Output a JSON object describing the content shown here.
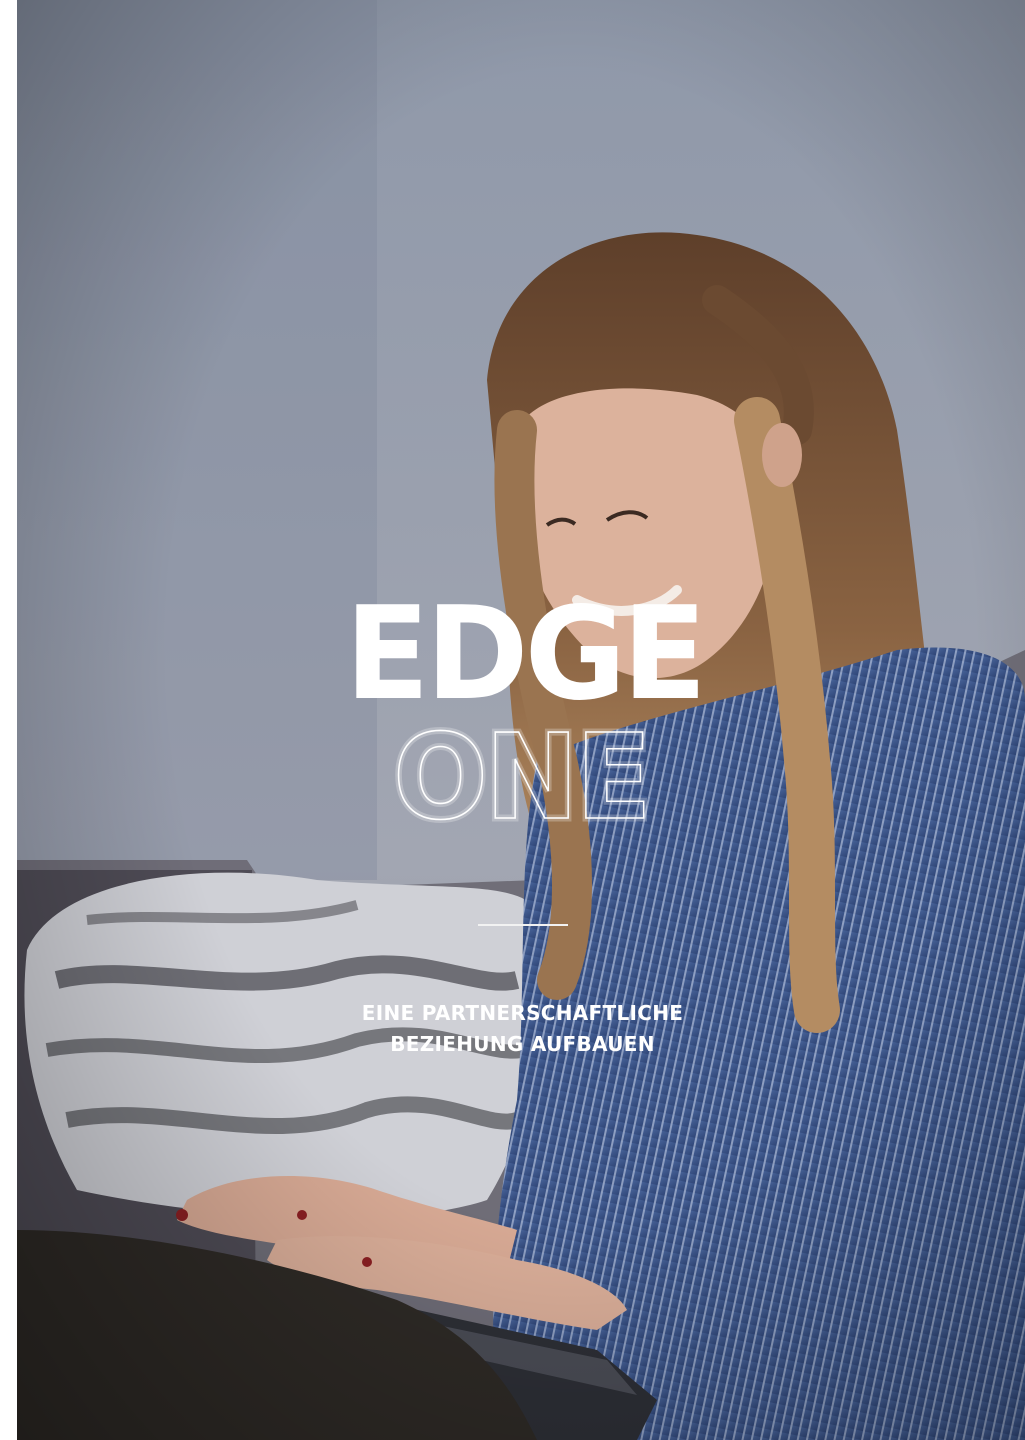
{
  "cover": {
    "title_line1": "EDGE",
    "title_line2": "ONE",
    "subtitle_line1": "EINE PARTNERSCHAFTLICHE",
    "subtitle_line2": "BEZIEHUNG AUFBAUEN"
  },
  "colors": {
    "title": "#ffffff",
    "subtitle": "#ffffff",
    "divider": "#f2f2f2",
    "shirt": "#3f5a8f",
    "hair": "#7a5637",
    "skin": "#d9b09b",
    "wall": "#9aa1b0"
  },
  "photo": {
    "subject": "woman-smiling-at-laptop-icon"
  }
}
